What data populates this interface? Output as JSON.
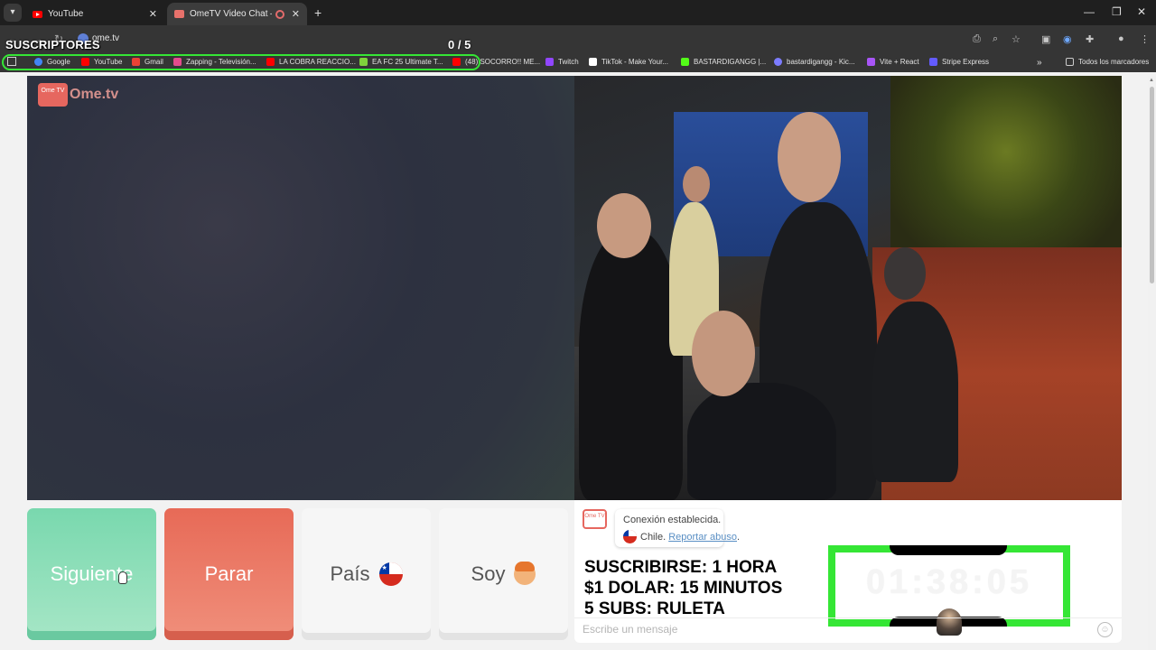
{
  "browser": {
    "tabs": [
      {
        "title": "YouTube",
        "active": false
      },
      {
        "title": "OmeTV Video Chat — Ome",
        "active": true
      }
    ],
    "url": "ome.tv",
    "bookmarks": [
      {
        "label": "Google",
        "icon": "google-icon",
        "color": "#4285f4"
      },
      {
        "label": "YouTube",
        "icon": "youtube-icon",
        "color": "#ff0000"
      },
      {
        "label": "Gmail",
        "icon": "gmail-icon",
        "color": "#ea4335"
      },
      {
        "label": "Zapping - Televisión...",
        "icon": "zapping-icon",
        "color": "#e44b8d"
      },
      {
        "label": "LA COBRA REACCIO...",
        "icon": "youtube-icon",
        "color": "#ff0000"
      },
      {
        "label": "EA FC 25 Ultimate T...",
        "icon": "ea-icon",
        "color": "#7fd23c"
      },
      {
        "label": "(48) SOCORRO!! ME...",
        "icon": "youtube-icon",
        "color": "#ff0000"
      },
      {
        "label": "Twitch",
        "icon": "twitch-icon",
        "color": "#9146ff"
      },
      {
        "label": "TikTok - Make Your...",
        "icon": "tiktok-icon",
        "color": "#ffffff"
      },
      {
        "label": "BASTARDIGANGG |...",
        "icon": "kick-icon",
        "color": "#53fc18"
      },
      {
        "label": "bastardigangg - Kic...",
        "icon": "link-icon",
        "color": "#7c7cff"
      },
      {
        "label": "Vite + React",
        "icon": "vite-icon",
        "color": "#a855f7"
      },
      {
        "label": "Stripe Express",
        "icon": "stripe-icon",
        "color": "#635bff"
      }
    ],
    "all_bookmarks": "Todos los marcadores"
  },
  "overlay": {
    "title": "SUSCRIPTORES",
    "count": "0 / 5",
    "accent": "#35e635"
  },
  "site": {
    "logo_badge": "Ome TV",
    "logo_text": "Ome.tv"
  },
  "controls": {
    "next": "Siguiente",
    "stop": "Parar",
    "country": "País",
    "me": "Soy"
  },
  "chat": {
    "status": "Conexión establecida.",
    "country": "Chile.",
    "report": "Reportar abuso",
    "input_placeholder": "Escribe un mensaje",
    "promo": [
      "SUSCRIBIRSE: 1 HORA",
      "$1 DOLAR: 15 MINUTOS",
      "5 SUBS: RULETA"
    ],
    "timer": "01:38:05"
  }
}
